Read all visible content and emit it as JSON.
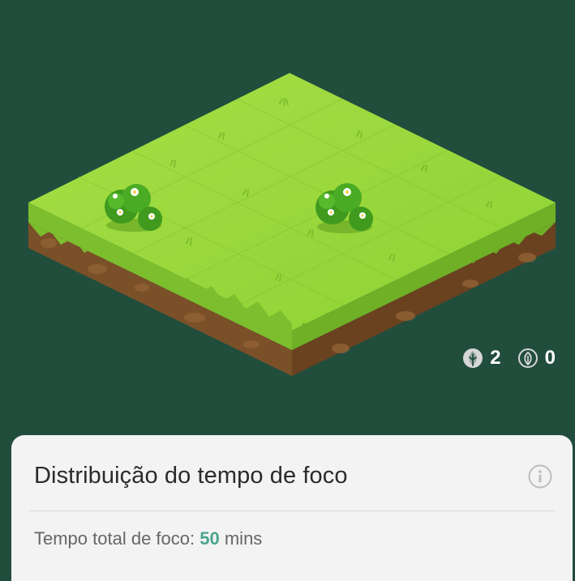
{
  "counters": {
    "planted_count": "2",
    "withered_count": "0",
    "planted_icon": "leaf-planted-icon",
    "withered_icon": "leaf-withered-icon"
  },
  "card": {
    "title": "Distribuição do tempo de foco",
    "info_icon": "info-icon",
    "stat_label": "Tempo total de foco:",
    "stat_value": "50",
    "stat_unit": "mins"
  },
  "scene": {
    "plants": [
      "flower-bush-icon",
      "flower-bush-icon"
    ]
  },
  "colors": {
    "background": "#214d3d",
    "grass_top": "#9ad93c",
    "dirt": "#7a5028",
    "accent_value": "#4aa58c"
  }
}
